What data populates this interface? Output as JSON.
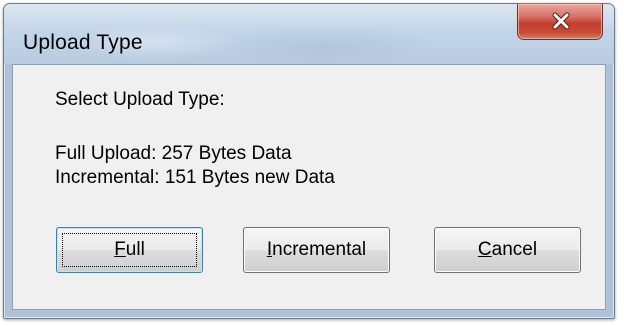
{
  "window": {
    "title": "Upload Type",
    "close_icon": "close-icon"
  },
  "dialog": {
    "prompt": "Select Upload Type:",
    "full_info": "Full Upload: 257 Bytes Data",
    "incremental_info": "Incremental: 151 Bytes new Data"
  },
  "buttons": {
    "full": {
      "mnemonic": "F",
      "rest": "ull"
    },
    "incremental": {
      "mnemonic": "I",
      "rest": "ncremental"
    },
    "cancel": {
      "mnemonic": "C",
      "rest": "ancel"
    }
  },
  "colors": {
    "close_button": "#c7442f",
    "dialog_background": "#f0f0f0",
    "default_button_border": "#3c7fb1"
  }
}
